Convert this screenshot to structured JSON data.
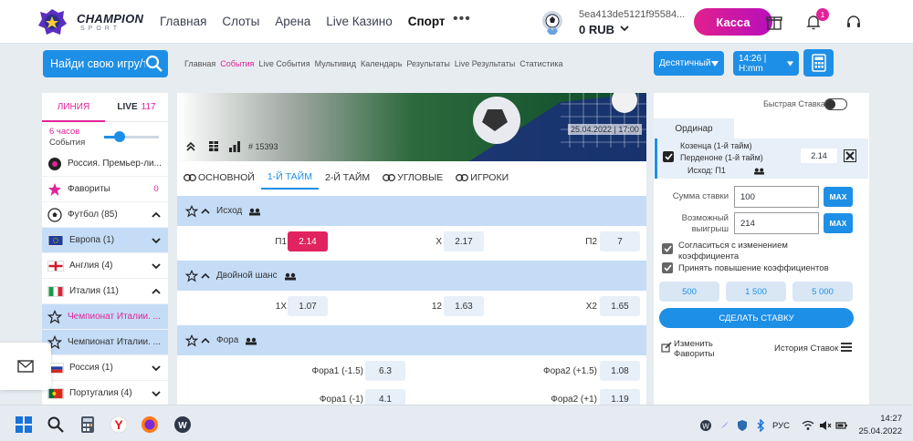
{
  "header": {
    "logo_text": "CHAMPION",
    "logo_sub": "SPORT",
    "nav": [
      "Главная",
      "Слоты",
      "Арена",
      "Live Казино",
      "Спорт"
    ],
    "user_id": "5ea413de5121f95584...",
    "balance": "0 RUB",
    "cashier_label": "Касса",
    "notification_count": "1"
  },
  "search": {
    "placeholder": "Найди свою игру/т"
  },
  "subnav": [
    "Главная",
    "События",
    "Live События",
    "Мультивид",
    "Календарь",
    "Результаты",
    "Live Результаты",
    "Статистика"
  ],
  "odds_format": "Десятичный",
  "time_format": "14:26 | H:mm",
  "sidebar": {
    "tab_line": "ЛИНИЯ",
    "tab_live": "LIVE",
    "live_count": "117",
    "hours": "6 часов",
    "events": "События",
    "items": [
      {
        "label": "Россия. Премьер-ли...",
        "right": ""
      },
      {
        "label": "Фавориты",
        "right": "0"
      },
      {
        "label": "Футбол (85)",
        "right": ""
      },
      {
        "label": "Европа (1)",
        "right": ""
      },
      {
        "label": "Англия (4)",
        "right": ""
      },
      {
        "label": "Италия (11)",
        "right": ""
      },
      {
        "label": "Чемпионат Италии. ...",
        "right": ""
      },
      {
        "label": "Чемпионат Италии. ...",
        "right": ""
      },
      {
        "label": "Россия (1)",
        "right": ""
      },
      {
        "label": "Португалия (4)",
        "right": ""
      }
    ]
  },
  "event": {
    "id": "# 15393",
    "datetime": "25.04.2022 | 17:00",
    "tabs": [
      "ОСНОВНОЙ",
      "1-Й ТАЙМ",
      "2-Й ТАЙМ",
      "УГЛОВЫЕ",
      "ИГРОКИ"
    ]
  },
  "markets": [
    {
      "title": "Исход",
      "rows": [
        [
          {
            "label": "П1",
            "odd": "2.14"
          },
          {
            "label": "X",
            "odd": "2.17"
          },
          {
            "label": "П2",
            "odd": "7"
          }
        ]
      ]
    },
    {
      "title": "Двойной шанс",
      "rows": [
        [
          {
            "label": "1X",
            "odd": "1.07"
          },
          {
            "label": "12",
            "odd": "1.63"
          },
          {
            "label": "X2",
            "odd": "1.65"
          }
        ]
      ]
    },
    {
      "title": "Фора",
      "rows": [
        [
          {
            "label": "Фора1 (-1.5)",
            "odd": "6.3"
          },
          {
            "label": "Фора2 (+1.5)",
            "odd": "1.08"
          }
        ],
        [
          {
            "label": "Фора1 (-1)",
            "odd": "4.1"
          },
          {
            "label": "Фора2 (+1)",
            "odd": "1.19"
          }
        ]
      ]
    }
  ],
  "betslip": {
    "quick_bet_label": "Быстрая Ставка",
    "type": "Ординар",
    "team1": "Козенца (1-й тайм)",
    "team2": "Перденоне (1-й тайм)",
    "outcome": "Исход: П1",
    "odd": "2.14",
    "stake_label": "Сумма ставки",
    "stake_value": "100",
    "win_label_1": "Возможный",
    "win_label_2": "выигрыш",
    "win_value": "214",
    "max_label": "MAX",
    "accept_change_1": "Согласиться с изменением",
    "accept_change_2": "коэффициента",
    "accept_increase": "Принять повышение коэффициентов",
    "quick_amounts": [
      "500",
      "1 500",
      "5 000"
    ],
    "place_bet": "СДЕЛАТЬ СТАВКУ",
    "edit_favorites_1": "Изменить",
    "edit_favorites_2": "Фавориты",
    "history": "История Ставок"
  },
  "taskbar": {
    "lang": "РУС",
    "time": "14:27",
    "date": "25.04.2022"
  }
}
